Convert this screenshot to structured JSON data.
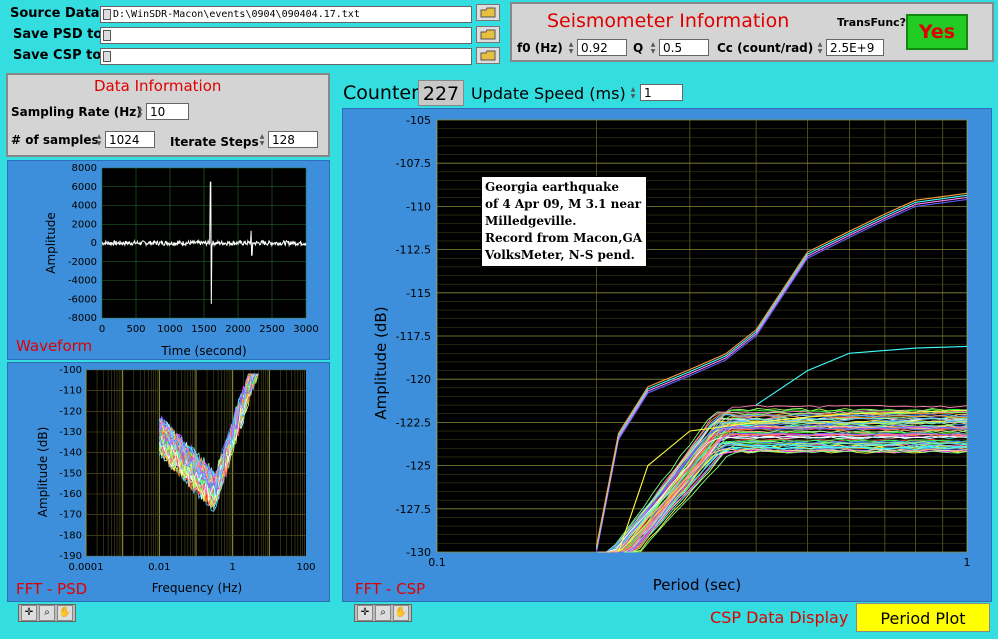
{
  "files": {
    "source_label": "Source Data",
    "source_value": "D:\\WinSDR-Macon\\events\\0904\\090404.17.txt",
    "psd_label": "Save PSD to",
    "psd_value": "",
    "csp_label": "Save CSP to",
    "csp_value": ""
  },
  "seismometer": {
    "title": "Seismometer Information",
    "transfunc_label": "TransFunc?",
    "transfunc_button": "Yes",
    "f0_label": "f0 (Hz)",
    "f0_value": "0.92",
    "q_label": "Q",
    "q_value": "0.5",
    "cc_label": "Cc (count/rad)",
    "cc_value": "2.5E+9"
  },
  "data_info": {
    "title": "Data Information",
    "sampling_label": "Sampling Rate (Hz)",
    "sampling_value": "10",
    "samples_label": "# of samples",
    "samples_value": "1024",
    "iterate_label": "Iterate Steps",
    "iterate_value": "128"
  },
  "counter": {
    "label": "Counter",
    "value": "227",
    "speed_label": "Update Speed (ms)",
    "speed_value": "1"
  },
  "waveform": {
    "label": "Waveform",
    "ylabel": "Amplitude",
    "xlabel": "Time (second)",
    "yticks": [
      "8000",
      "6000",
      "4000",
      "2000",
      "0",
      "-2000",
      "-4000",
      "-6000",
      "-8000"
    ],
    "xticks": [
      "0",
      "500",
      "1000",
      "1500",
      "2000",
      "2500",
      "3000"
    ]
  },
  "psd": {
    "label": "FFT - PSD",
    "ylabel": "Amplitude (dB)",
    "xlabel": "Frequency (Hz)",
    "yticks": [
      "-100",
      "-110",
      "-120",
      "-130",
      "-140",
      "-150",
      "-160",
      "-170",
      "-180",
      "-190"
    ],
    "xticks": [
      "0.0001",
      "0.01",
      "1",
      "100"
    ]
  },
  "csp": {
    "label": "FFT - CSP",
    "ylabel": "Amplitude (dB)",
    "xlabel": "Period (sec)",
    "yticks": [
      "-105",
      "-107.5",
      "-110",
      "-112.5",
      "-115",
      "-117.5",
      "-120",
      "-122.5",
      "-125",
      "-127.5",
      "-130"
    ],
    "xticks": [
      "0.1",
      "1"
    ],
    "annotation": [
      "Georgia earthquake",
      "of 4 Apr 09, M 3.1 near",
      "Milledgeville.",
      "Record from Macon,GA",
      "VolksMeter, N-S pend."
    ]
  },
  "display": {
    "label": "CSP Data Display",
    "button": "Period Plot"
  },
  "colors": {
    "background": "#33dde0",
    "plot_bg": "#000000",
    "accent_red": "#e00000",
    "yes_green": "#22cc22",
    "period_yellow": "#ffff00"
  },
  "chart_data": [
    {
      "type": "line",
      "title": "Waveform",
      "xlabel": "Time (second)",
      "ylabel": "Amplitude",
      "xlim": [
        0,
        3000
      ],
      "ylim": [
        -8000,
        8000
      ],
      "grid": true,
      "series": [
        {
          "x": [
            0,
            500,
            1000,
            1500,
            1580,
            1600,
            1620,
            1700,
            2000,
            2200,
            2500,
            3000
          ],
          "y": [
            0,
            0,
            0,
            0,
            1000,
            6500,
            -6500,
            0,
            0,
            500,
            0,
            0
          ]
        }
      ]
    },
    {
      "type": "line",
      "title": "FFT - PSD",
      "xlabel": "Frequency (Hz)",
      "ylabel": "Amplitude (dB)",
      "xscale": "log",
      "xlim": [
        0.0001,
        100
      ],
      "ylim": [
        -190,
        -100
      ],
      "grid": true,
      "series": [
        {
          "x": [
            0.01,
            0.03,
            0.1,
            0.3,
            1,
            2,
            5
          ],
          "y": [
            -130,
            -140,
            -150,
            -160,
            -110,
            -105,
            -110
          ]
        }
      ]
    },
    {
      "type": "line",
      "title": "FFT - CSP",
      "xlabel": "Period (sec)",
      "ylabel": "Amplitude (dB)",
      "xscale": "log",
      "xlim": [
        0.1,
        1
      ],
      "ylim": [
        -130,
        -105
      ],
      "grid": true,
      "series": [
        {
          "x": [
            0.2,
            0.22,
            0.25,
            0.3,
            0.35,
            0.4,
            0.5,
            0.6,
            0.7,
            0.8,
            1.0
          ],
          "y": [
            -130,
            -123.5,
            -120.8,
            -119.8,
            -118.9,
            -117.5,
            -113,
            -111.8,
            -110.8,
            -110,
            -109.6
          ]
        },
        {
          "x": [
            0.22,
            0.25,
            0.3,
            0.4,
            0.5,
            0.6,
            0.8,
            1.0
          ],
          "y": [
            -130,
            -125,
            -123,
            -122.5,
            -122.2,
            -122,
            -121.9,
            -121.8
          ]
        },
        {
          "x": [
            0.4,
            0.5,
            0.6,
            0.8,
            1.0
          ],
          "y": [
            -121.5,
            -119.5,
            -118.5,
            -118.2,
            -118.1
          ]
        }
      ]
    }
  ]
}
